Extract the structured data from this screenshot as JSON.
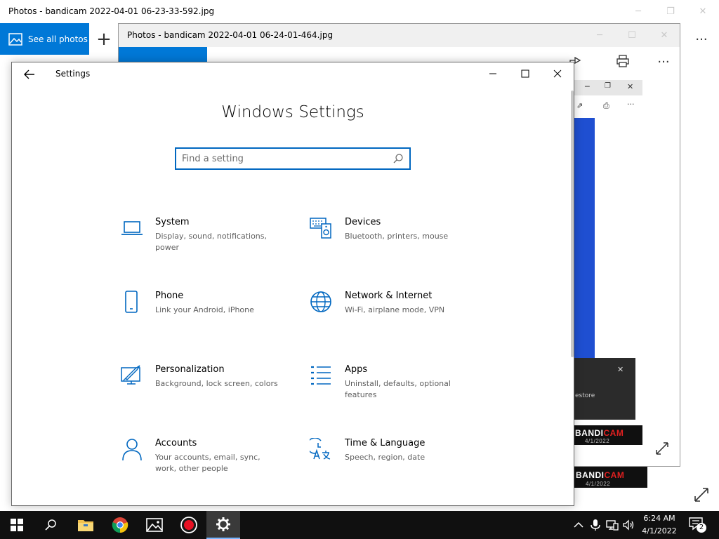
{
  "background_window_1": {
    "title": "Photos - bandicam 2022-04-01 06-23-33-592.jpg",
    "see_all_photos": "See all photos",
    "plus": "+",
    "more": "···"
  },
  "background_window_2": {
    "title": "Photos - bandicam 2022-04-01 06-24-01-464.jpg",
    "inner_dialog_text": "estore",
    "bandicam_logo_1": {
      "prefix": "BANDI",
      "suffix": "CAM",
      "date": "4/1/2022"
    },
    "bandicam_logo_2": {
      "prefix": "BANDI",
      "suffix": "CAM",
      "date": "4/1/2022"
    }
  },
  "settings": {
    "window_title": "Settings",
    "page_title": "Windows Settings",
    "search_placeholder": "Find a setting",
    "categories": [
      {
        "title": "System",
        "description": "Display, sound, notifications, power",
        "icon": "laptop-icon"
      },
      {
        "title": "Devices",
        "description": "Bluetooth, printers, mouse",
        "icon": "keyboard-speaker-icon"
      },
      {
        "title": "Phone",
        "description": "Link your Android, iPhone",
        "icon": "phone-icon"
      },
      {
        "title": "Network & Internet",
        "description": "Wi-Fi, airplane mode, VPN",
        "icon": "globe-icon"
      },
      {
        "title": "Personalization",
        "description": "Background, lock screen, colors",
        "icon": "paint-icon"
      },
      {
        "title": "Apps",
        "description": "Uninstall, defaults, optional features",
        "icon": "apps-list-icon"
      },
      {
        "title": "Accounts",
        "description": "Your accounts, email, sync, work, other people",
        "icon": "person-icon"
      },
      {
        "title": "Time & Language",
        "description": "Speech, region, date",
        "icon": "time-language-icon"
      }
    ]
  },
  "taskbar": {
    "clock_time": "6:24 AM",
    "clock_date": "4/1/2022",
    "notification_count": "2"
  },
  "colors": {
    "accent": "#0078d7",
    "icon_blue": "#0067c0",
    "taskbar": "#101010"
  }
}
